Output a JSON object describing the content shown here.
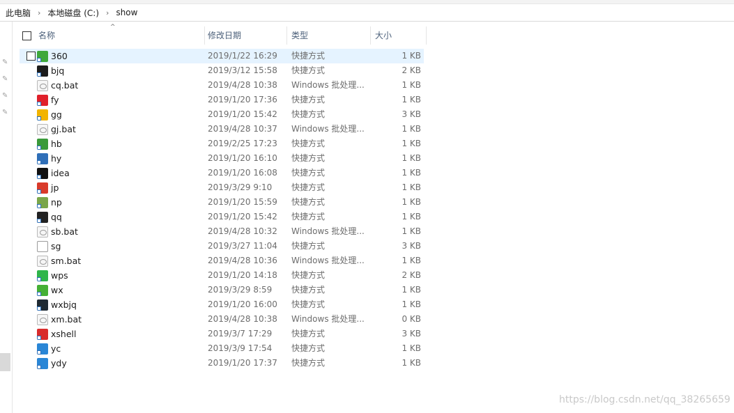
{
  "breadcrumb": {
    "items": [
      "此电脑",
      "本地磁盘 (C:)",
      "show"
    ],
    "separator": "›"
  },
  "columns": {
    "name": "名称",
    "date": "修改日期",
    "type": "类型",
    "size": "大小"
  },
  "files": [
    {
      "name": "360",
      "date": "2019/1/22 16:29",
      "type": "快捷方式",
      "size": "1 KB",
      "icon": "360-browser-icon",
      "color": "#3fa83a"
    },
    {
      "name": "bjq",
      "date": "2019/3/12 15:58",
      "type": "快捷方式",
      "size": "2 KB",
      "icon": "webstorm-icon",
      "color": "#1c1c1c"
    },
    {
      "name": "cq.bat",
      "date": "2019/4/28 10:38",
      "type": "Windows 批处理...",
      "size": "1 KB",
      "icon": "batch-file-icon",
      "color": "#9a9a9a"
    },
    {
      "name": "fy",
      "date": "2019/1/20 17:36",
      "type": "快捷方式",
      "size": "1 KB",
      "icon": "youdao-icon",
      "color": "#e0202a"
    },
    {
      "name": "gg",
      "date": "2019/1/20 15:42",
      "type": "快捷方式",
      "size": "3 KB",
      "icon": "chrome-icon",
      "color": "#f2b400"
    },
    {
      "name": "gj.bat",
      "date": "2019/4/28 10:37",
      "type": "Windows 批处理...",
      "size": "1 KB",
      "icon": "batch-file-icon",
      "color": "#9a9a9a"
    },
    {
      "name": "hb",
      "date": "2019/2/25 17:23",
      "type": "快捷方式",
      "size": "1 KB",
      "icon": "hbuilder-icon",
      "color": "#3a9a3a"
    },
    {
      "name": "hy",
      "date": "2019/1/20 16:10",
      "type": "快捷方式",
      "size": "1 KB",
      "icon": "hy-icon",
      "color": "#2f6fb8"
    },
    {
      "name": "idea",
      "date": "2019/1/20 16:08",
      "type": "快捷方式",
      "size": "1 KB",
      "icon": "intellij-idea-icon",
      "color": "#111111"
    },
    {
      "name": "jp",
      "date": "2019/3/29 9:10",
      "type": "快捷方式",
      "size": "1 KB",
      "icon": "jp-icon",
      "color": "#d93a2a"
    },
    {
      "name": "np",
      "date": "2019/1/20 15:59",
      "type": "快捷方式",
      "size": "1 KB",
      "icon": "notepad-icon",
      "color": "#7aa64a"
    },
    {
      "name": "qq",
      "date": "2019/1/20 15:42",
      "type": "快捷方式",
      "size": "1 KB",
      "icon": "qq-icon",
      "color": "#222222"
    },
    {
      "name": "sb.bat",
      "date": "2019/4/28 10:32",
      "type": "Windows 批处理...",
      "size": "1 KB",
      "icon": "batch-file-icon",
      "color": "#9a9a9a"
    },
    {
      "name": "sg",
      "date": "2019/3/27 11:04",
      "type": "快捷方式",
      "size": "3 KB",
      "icon": "blank-file-icon",
      "color": "#9a9a9a"
    },
    {
      "name": "sm.bat",
      "date": "2019/4/28 10:36",
      "type": "Windows 批处理...",
      "size": "1 KB",
      "icon": "batch-file-icon",
      "color": "#9a9a9a"
    },
    {
      "name": "wps",
      "date": "2019/1/20 14:18",
      "type": "快捷方式",
      "size": "2 KB",
      "icon": "wps-icon",
      "color": "#2fb54a"
    },
    {
      "name": "wx",
      "date": "2019/3/29 8:59",
      "type": "快捷方式",
      "size": "1 KB",
      "icon": "wechat-icon",
      "color": "#45b035"
    },
    {
      "name": "wxbjq",
      "date": "2019/1/20 16:00",
      "type": "快捷方式",
      "size": "1 KB",
      "icon": "wechat-devtools-icon",
      "color": "#1f2a33"
    },
    {
      "name": "xm.bat",
      "date": "2019/4/28 10:38",
      "type": "Windows 批处理...",
      "size": "0 KB",
      "icon": "batch-file-icon",
      "color": "#9a9a9a"
    },
    {
      "name": "xshell",
      "date": "2019/3/7 17:29",
      "type": "快捷方式",
      "size": "3 KB",
      "icon": "xshell-icon",
      "color": "#d92c2c"
    },
    {
      "name": "yc",
      "date": "2019/3/9 17:54",
      "type": "快捷方式",
      "size": "1 KB",
      "icon": "yc-icon",
      "color": "#2a86d6"
    },
    {
      "name": "ydy",
      "date": "2019/1/20 17:37",
      "type": "快捷方式",
      "size": "1 KB",
      "icon": "ydy-icon",
      "color": "#2a86d6"
    }
  ],
  "watermark": "https://blog.csdn.net/qq_38265659"
}
